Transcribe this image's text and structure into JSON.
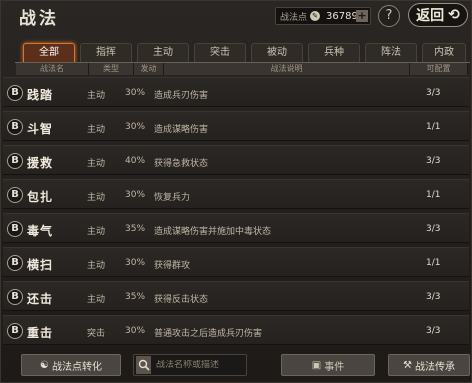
{
  "header": {
    "title": "战法",
    "points_label": "战法点",
    "points_value": "36789",
    "plus": "+",
    "help": "?",
    "back_label": "返回"
  },
  "tabs": [
    {
      "label": "全部",
      "active": true
    },
    {
      "label": "指挥",
      "active": false
    },
    {
      "label": "主动",
      "active": false
    },
    {
      "label": "突击",
      "active": false
    },
    {
      "label": "被动",
      "active": false
    },
    {
      "label": "兵种",
      "active": false
    },
    {
      "label": "阵法",
      "active": false
    },
    {
      "label": "内政",
      "active": false
    }
  ],
  "columns": {
    "name": "战法名",
    "type": "类型",
    "rate": "发动",
    "desc": "战法说明",
    "avail": "可配置"
  },
  "rows": [
    {
      "grade": "B",
      "name": "践踏",
      "type": "主动",
      "rate": "30%",
      "desc": "造成兵刃伤害",
      "avail": "3/3"
    },
    {
      "grade": "B",
      "name": "斗智",
      "type": "主动",
      "rate": "30%",
      "desc": "造成谋略伤害",
      "avail": "1/1"
    },
    {
      "grade": "B",
      "name": "援救",
      "type": "主动",
      "rate": "40%",
      "desc": "获得急救状态",
      "avail": "3/3"
    },
    {
      "grade": "B",
      "name": "包扎",
      "type": "主动",
      "rate": "30%",
      "desc": "恢复兵力",
      "avail": "1/1"
    },
    {
      "grade": "B",
      "name": "毒气",
      "type": "主动",
      "rate": "35%",
      "desc": "造成谋略伤害并施加中毒状态",
      "avail": "3/3"
    },
    {
      "grade": "B",
      "name": "横扫",
      "type": "主动",
      "rate": "30%",
      "desc": "获得群攻",
      "avail": "1/1"
    },
    {
      "grade": "B",
      "name": "还击",
      "type": "主动",
      "rate": "35%",
      "desc": "获得反击状态",
      "avail": "3/3"
    },
    {
      "grade": "B",
      "name": "重击",
      "type": "突击",
      "rate": "30%",
      "desc": "普通攻击之后造成兵刃伤害",
      "avail": "3/3"
    }
  ],
  "footer": {
    "convert_label": "战法点转化",
    "search_placeholder": "战法名称或描述",
    "events_label": "事件",
    "inherit_label": "战法传承"
  },
  "colors": {
    "accent": "#d9752e",
    "background": "#1a1816"
  }
}
